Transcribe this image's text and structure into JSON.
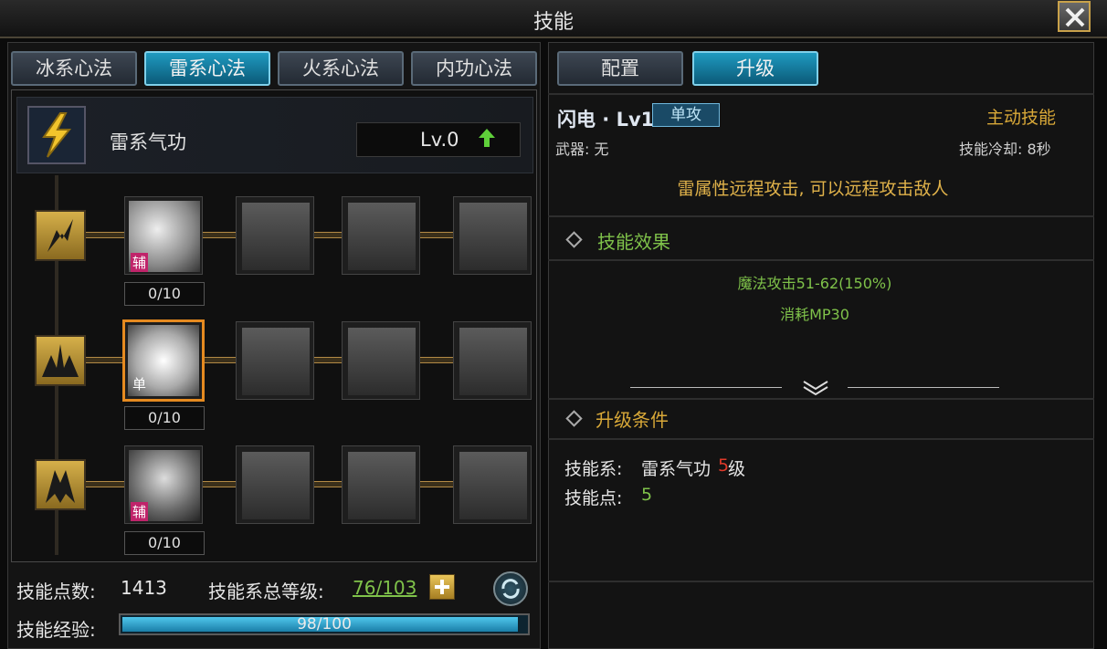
{
  "window": {
    "title": "技能"
  },
  "tabs": [
    {
      "label": "冰系心法",
      "active": false
    },
    {
      "label": "雷系心法",
      "active": true
    },
    {
      "label": "火系心法",
      "active": false
    },
    {
      "label": "内功心法",
      "active": false
    }
  ],
  "school": {
    "name": "雷系气功",
    "level": "Lv.0"
  },
  "rows": [
    {
      "icon": "lightning-bolt-icon",
      "skill_tag": "辅",
      "count": "0/10",
      "selected": false
    },
    {
      "icon": "lightning-burst-icon",
      "skill_tag": "单",
      "count": "0/10",
      "selected": true
    },
    {
      "icon": "lightning-figure-icon",
      "skill_tag": "辅",
      "count": "0/10",
      "selected": false
    }
  ],
  "footer": {
    "skill_points_label": "技能点数:",
    "skill_points_value": "1413",
    "total_level_label": "技能系总等级:",
    "total_level_value": "76/103",
    "exp_label": "技能经验:",
    "exp_text": "98/100",
    "exp_fraction": 0.98
  },
  "right_tabs": [
    {
      "label": "配置",
      "active": false
    },
    {
      "label": "升级",
      "active": true
    }
  ],
  "detail": {
    "skill_name": "闪电 · Lv1",
    "target_badge": "单攻",
    "skill_type": "主动技能",
    "weapon_label": "武器: 无",
    "cooldown_label": "技能冷却: 8秒",
    "description": "雷属性远程攻击, 可以远程攻击敌人",
    "effect_title": "技能效果",
    "effects": [
      "魔法攻击51-62(150%)",
      "消耗MP30"
    ],
    "upgrade_title": "升级条件",
    "req_school_label": "技能系:",
    "req_school_value": "雷系气功",
    "req_school_level": "5",
    "req_school_unit": "级",
    "req_points_label": "技能点:",
    "req_points_value": "5"
  },
  "colors": {
    "accent_gold": "#d8a838",
    "effect_green": "#7fc24a",
    "req_red": "#e03a2a",
    "tab_active": "#1f9ac0"
  }
}
